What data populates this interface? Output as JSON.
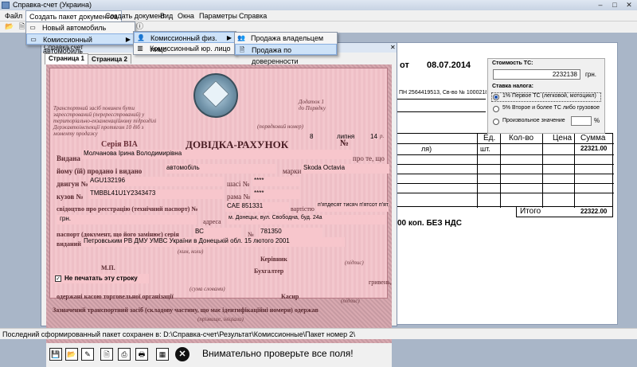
{
  "window": {
    "title": "Справка-счет (Украина)",
    "min": "–",
    "max": "□",
    "close": "✕"
  },
  "menu": {
    "file": "Файл",
    "create_package": "Создать пакет документов",
    "create_doc": "Создать документ",
    "view": "Вид",
    "windows": "Окна",
    "params": "Параметры",
    "help": "Справка"
  },
  "dropdown1": {
    "new_car": "Новый автомобиль",
    "commission_car": "Комиссионный автомобиль"
  },
  "dropdown2": {
    "individual": "Комиссионный физ. лицо",
    "legal": "Комиссионный юр. лицо"
  },
  "dropdown3": {
    "owner_sale": "Продажа владельцем",
    "proxy_sale": "Продажа по доверенности"
  },
  "mdi": {
    "label": "Справка счет"
  },
  "invoice": {
    "from_label": "от",
    "date": "08.07.2014",
    "requisites": "ПН 2564419513, Св-во № 10002189",
    "head_unit": "Ед.",
    "head_qty": "Кол-во",
    "head_price": "Цена",
    "head_sum": "Сумма",
    "row1_name": "ля)",
    "row1_unit": "шт.",
    "row1_sum": "22321.00",
    "total_label": "Итого",
    "total_value": "22322.00",
    "sum_words": "00 коп. БЕЗ НДС"
  },
  "panel": {
    "cost_label": "Стоимость ТС:",
    "cost_value": "2232138",
    "currency": "грн.",
    "tax_label": "Ставка налога:",
    "opt1": "1% Первое ТС (легковой, мотоцикл)",
    "opt2": "5% Второе и более ТС либо грузовое",
    "opt3": "Произвольное значение",
    "percent": "%"
  },
  "doc": {
    "title": "Справка счет",
    "tab1": "Страница 1",
    "tab2": "Страница 2",
    "left_note": "Транспортний засіб повинен бути зареєстрований (перереєстрований) у територіально-екзаменаційному підрозділі Державтоінспекції протягом 10 діб з моменту продажу",
    "right_note1": "Додаток 1",
    "right_note2": "до Порядку",
    "day_label": "(порядковий номер)",
    "day": "8",
    "month": "липня",
    "year": "14",
    "year_suffix": "р.",
    "seria": "Серія ВІА",
    "main_title": "ДОВІДКА-РАХУНОК",
    "no": "№",
    "vydana_label": "Видана",
    "vydana_value": "Молчанова Ірина Володимирівна",
    "pro_te": "про те, що",
    "yomu_label": "йому (їй) продано і видано",
    "yomu_value": "автомобіль",
    "marka_label": "марки",
    "marka_value": "Skoda Octavia",
    "dvygun_label": "двигун №",
    "dvygun_value": "AGU132196",
    "shasi_label": "шасі №",
    "shasi_value": "****",
    "kuzov_label": "кузов №",
    "kuzov_value": "TMBBL41U1Y2343473",
    "rama_label": "рама №",
    "rama_value": "****",
    "svid_label": "свідоцтво про реєстрацію (технічний паспорт) №",
    "svid_value": "САЕ 851331",
    "vart_label": "вартістю",
    "vart_value": "п'ятдесят тисяч п'ятсот п'ятдеся",
    "grn": "грн.",
    "adresa_label": "адреса",
    "adresa_value": "м. Донецьк, вул. Свободна, буд. 24а",
    "pasport_label": "паспорт (документ, що його замінює) серія",
    "pasport_seria": "ВС",
    "pasport_no_label": "№",
    "pasport_no": "781350",
    "vydanyi_label": "виданий",
    "vydanyi_value": "Петровським РВ ДМУ УМВС України в Донецькій обл. 15 лютого 2001",
    "kim_koly": "(ким, коли)",
    "kerivnyk": "Керівник",
    "pidpys": "(підпис)",
    "mp": "М.П.",
    "buhgalter": "Бухгалтер",
    "no_print": "Не печатать эту строку",
    "suma_label": "(сума словами)",
    "gryven": "гривень,",
    "odergani": "одержані касою торговельної організації",
    "kasyr": "Касир",
    "zaznach": "Зазначений транспортний засіб (складову частину, що має ідентифікаційні номери) одержав",
    "pib": "(прізвище, ініціали)",
    "warning": "Внимательно проверьте все поля!"
  },
  "status": {
    "text": "Последний сформированный пакет сохранен в: D:\\Справка-счет\\Результат\\Комиссионные\\Пакет номер 2\\"
  }
}
